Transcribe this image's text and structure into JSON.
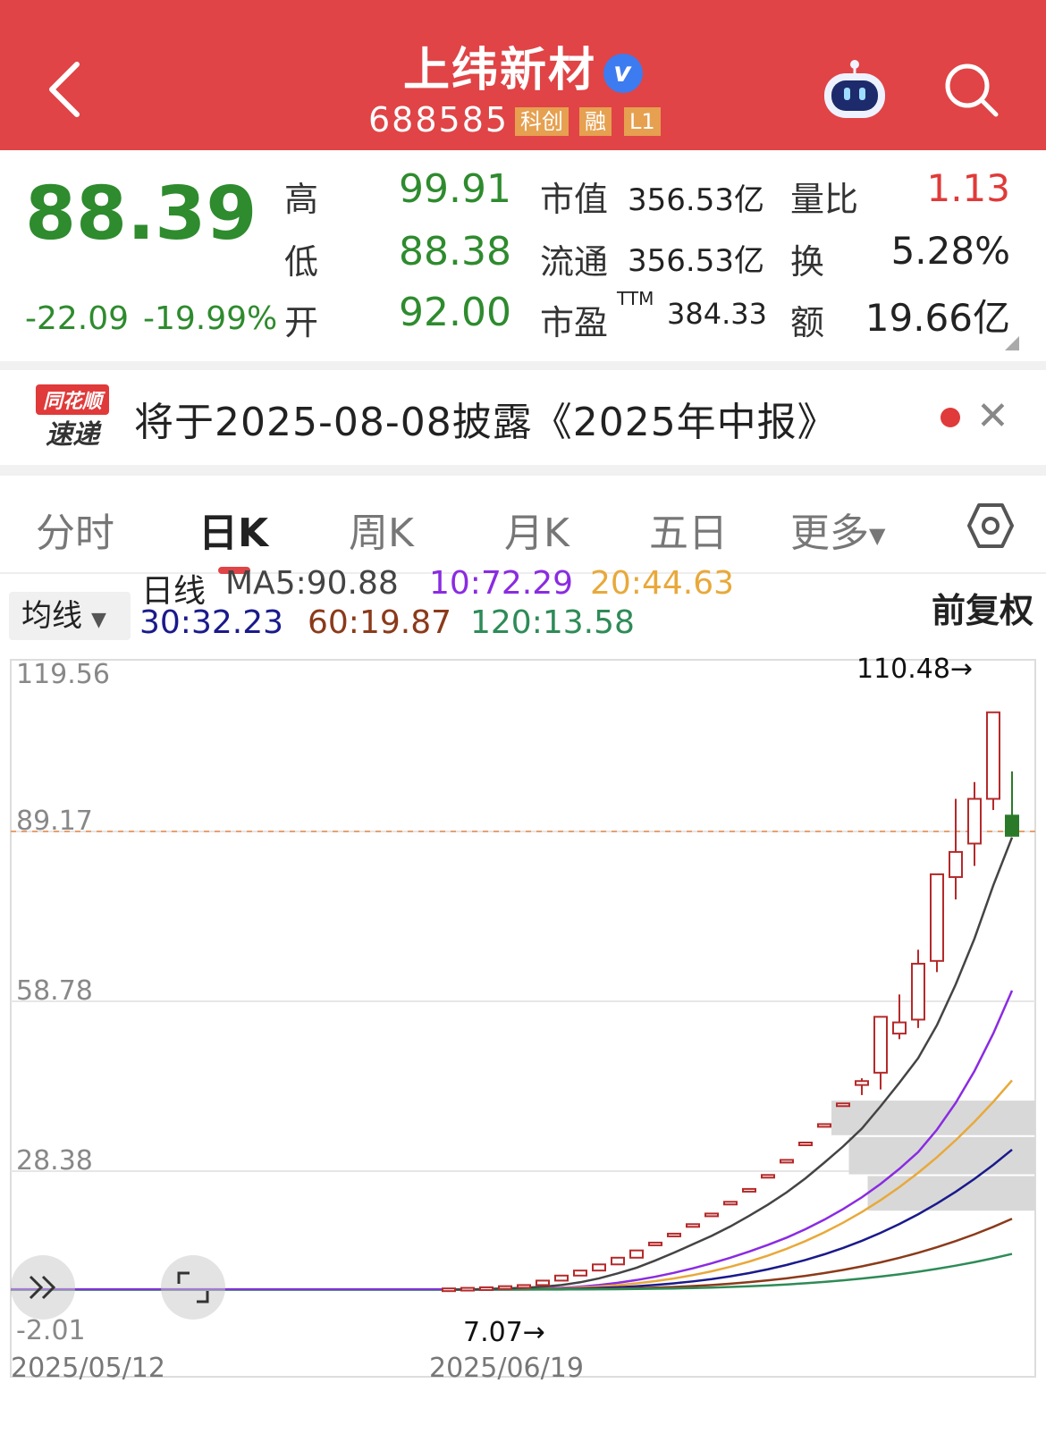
{
  "header": {
    "stock_name": "上纬新材",
    "verified_badge": "v",
    "stock_code": "688585",
    "tags": [
      "科创",
      "融",
      "L1"
    ]
  },
  "quote": {
    "price": "88.39",
    "change": "-22.09",
    "change_pct": "-19.99%",
    "high_label": "高",
    "high": "99.91",
    "low_label": "低",
    "low": "88.38",
    "open_label": "开",
    "open": "92.00",
    "mktcap_label": "市值",
    "mktcap": "356.53亿",
    "float_label": "流通",
    "float": "356.53亿",
    "pe_label": "市盈",
    "pe_sup": "TTM",
    "pe": "384.33",
    "vol_ratio_label": "量比",
    "vol_ratio": "1.13",
    "turnover_label": "换",
    "turnover": "5.28%",
    "amount_label": "额",
    "amount": "19.66亿"
  },
  "notice": {
    "logo_top": "同花顺",
    "logo_bottom": "速递",
    "text": "将于2025-08-08披露《2025年中报》"
  },
  "tabs": [
    "分时",
    "日K",
    "周K",
    "月K",
    "五日",
    "更多"
  ],
  "active_tab": "日K",
  "ma": {
    "button": "均线",
    "label": "日线",
    "ma5": "MA5:90.88",
    "ma10": "10:72.29",
    "ma20": "20:44.63",
    "ma30": "30:32.23",
    "ma60": "60:19.87",
    "ma120": "120:13.58",
    "adjust": "前复权",
    "colors": {
      "ma5": "#444444",
      "ma10": "#8a2be2",
      "ma20": "#e8a93a",
      "ma30": "#1a1a8c",
      "ma60": "#8b3a1a",
      "ma120": "#2e8b57"
    }
  },
  "chart_data": {
    "type": "candlestick",
    "y_ticks": [
      "119.56",
      "89.17",
      "58.78",
      "28.38",
      "-2.01"
    ],
    "ylim": [
      -2.01,
      119.56
    ],
    "reference_price": 89.17,
    "x_labels": [
      "2025/05/12",
      "2025/06/19"
    ],
    "annotations": {
      "max": "110.48→",
      "min": "7.07→"
    },
    "candles": [
      {
        "o": 7.3,
        "c": 7.4,
        "h": 7.5,
        "l": 7.2
      },
      {
        "o": 7.4,
        "c": 7.5,
        "h": 7.6,
        "l": 7.3
      },
      {
        "o": 7.5,
        "c": 7.6,
        "h": 7.7,
        "l": 7.4
      },
      {
        "o": 7.6,
        "c": 7.8,
        "h": 7.9,
        "l": 7.5
      },
      {
        "o": 7.8,
        "c": 8.0,
        "h": 8.1,
        "l": 7.7
      },
      {
        "o": 8.0,
        "c": 8.8,
        "h": 8.8,
        "l": 8.0
      },
      {
        "o": 8.8,
        "c": 9.7,
        "h": 9.7,
        "l": 8.8
      },
      {
        "o": 9.7,
        "c": 10.6,
        "h": 10.6,
        "l": 9.7
      },
      {
        "o": 10.6,
        "c": 11.7,
        "h": 11.7,
        "l": 10.6
      },
      {
        "o": 11.7,
        "c": 12.9,
        "h": 12.9,
        "l": 11.7
      },
      {
        "o": 12.9,
        "c": 14.2,
        "h": 14.2,
        "l": 12.9
      },
      {
        "o": 15.6,
        "c": 15.6,
        "h": 15.6,
        "l": 15.6
      },
      {
        "o": 17.2,
        "c": 17.2,
        "h": 17.2,
        "l": 17.2
      },
      {
        "o": 18.9,
        "c": 18.9,
        "h": 18.9,
        "l": 18.9
      },
      {
        "o": 20.8,
        "c": 20.8,
        "h": 20.8,
        "l": 20.8
      },
      {
        "o": 22.9,
        "c": 22.9,
        "h": 22.9,
        "l": 22.9
      },
      {
        "o": 25.2,
        "c": 25.2,
        "h": 25.2,
        "l": 25.2
      },
      {
        "o": 27.7,
        "c": 27.7,
        "h": 27.7,
        "l": 27.7
      },
      {
        "o": 30.4,
        "c": 30.4,
        "h": 30.4,
        "l": 30.4
      },
      {
        "o": 33.5,
        "c": 33.5,
        "h": 33.5,
        "l": 33.5
      },
      {
        "o": 36.8,
        "c": 36.8,
        "h": 36.8,
        "l": 36.8
      },
      {
        "o": 40.5,
        "c": 40.5,
        "h": 40.5,
        "l": 40.5
      },
      {
        "o": 43.8,
        "c": 44.5,
        "h": 45.0,
        "l": 42.0
      },
      {
        "o": 46.0,
        "c": 56.0,
        "h": 56.0,
        "l": 43.0
      },
      {
        "o": 53.0,
        "c": 55.0,
        "h": 60.0,
        "l": 52.0
      },
      {
        "o": 55.5,
        "c": 65.5,
        "h": 68.0,
        "l": 54.0
      },
      {
        "o": 66.0,
        "c": 81.5,
        "h": 81.5,
        "l": 64.0
      },
      {
        "o": 81.0,
        "c": 85.5,
        "h": 95.0,
        "l": 77.0
      },
      {
        "o": 87.0,
        "c": 95.0,
        "h": 98.0,
        "l": 83.0
      },
      {
        "o": 95.0,
        "c": 110.48,
        "h": 110.48,
        "l": 93.0
      },
      {
        "o": 92.0,
        "c": 88.39,
        "h": 99.91,
        "l": 88.38
      }
    ],
    "ma_lines": {
      "ma5": [
        7.2,
        7.2,
        7.3,
        7.4,
        7.5,
        7.7,
        8.0,
        8.5,
        9.2,
        10.1,
        11.1,
        12.4,
        13.8,
        15.3,
        16.8,
        18.5,
        20.4,
        22.4,
        24.6,
        27.1,
        29.9,
        32.8,
        36.0,
        40.0,
        44.2,
        48.6,
        54.5,
        61.8,
        70.0,
        79.5,
        88.1
      ],
      "ma10": [
        7.2,
        7.2,
        7.2,
        7.3,
        7.3,
        7.4,
        7.5,
        7.7,
        8.0,
        8.4,
        8.9,
        9.5,
        10.2,
        11.0,
        11.9,
        12.9,
        14.0,
        15.2,
        16.5,
        18.0,
        19.7,
        21.6,
        23.7,
        26.1,
        28.8,
        31.8,
        35.8,
        40.6,
        46.3,
        53.0,
        60.7
      ]
    },
    "extra_ma_lines_last": {
      "ma20": 44.63,
      "ma30": 32.23,
      "ma60": 19.87,
      "ma120": 13.58
    },
    "chip_blocks": [
      {
        "from": 21.0,
        "to": 27.5
      },
      {
        "from": 27.5,
        "to": 34.5
      },
      {
        "from": 34.5,
        "to": 41.0
      }
    ]
  }
}
